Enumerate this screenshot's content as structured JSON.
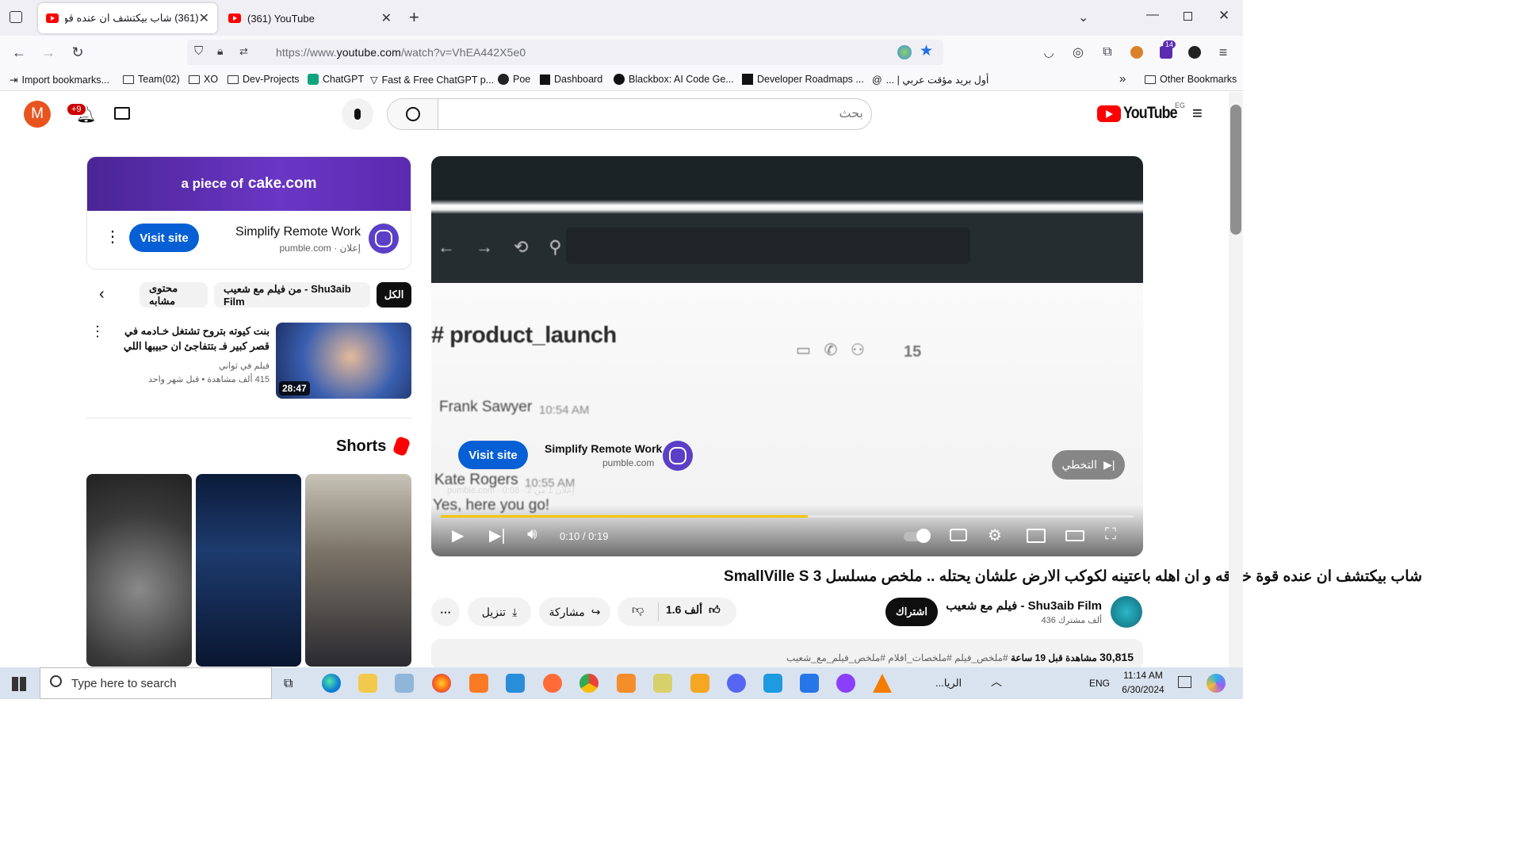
{
  "browser": {
    "tabs": [
      {
        "title": "(361) شاب بيكتشف ان عنده قو",
        "active": true
      },
      {
        "title": "(361) YouTube",
        "active": false
      }
    ],
    "new_tab": "+",
    "url": {
      "prefix": "https://www.",
      "domain": "youtube.com",
      "path": "/watch?v=VhEA442X5e0"
    },
    "extension_badge": "14",
    "bookmarks": [
      "Import bookmarks...",
      "Team(02)",
      "XO",
      "Dev-Projects",
      "ChatGPT",
      "Fast & Free ChatGPT p...",
      "Poe",
      "Dashboard",
      "Blackbox: AI Code Ge...",
      "Developer Roadmaps ...",
      "أول بريد مؤقت عربي | ...",
      "Other Bookmarks"
    ]
  },
  "youtube": {
    "avatar_letter": "M",
    "notifications": "+9",
    "search_placeholder": "بحث",
    "logo": "YouTube",
    "country": "EG",
    "ad": {
      "banner_text": "a piece of",
      "banner_brand": "cake.com",
      "title": "Simplify Remote Work",
      "sub": "pumble.com · إعلان",
      "cta": "Visit site"
    },
    "chips": [
      "الكل",
      "من فيلم مع شعيب - Shu3aib Film",
      "محتوى مشابه"
    ],
    "related": {
      "title": "بنت كيوته بتروح تشتغل خـادمه في قصر كبير فـ بتتفاجئ ان حبيبها اللي اتخلت عنه يبقى غـ...",
      "channel": "فيلم في ثواني",
      "views": "415 ألف مشاهدة",
      "age": "قبل شهر واحد",
      "duration": "28:47"
    },
    "shorts_label": "Shorts",
    "player": {
      "channel_text": "# product_launch",
      "member_count": "15",
      "msg_user": "Frank Sawyer",
      "msg_time": "10:54 AM",
      "msg2_user": "Kate Rogers",
      "msg2_time": "10:55 AM",
      "msg2_text": "Yes, here you go!",
      "overlay_title": "Simplify Remote Work",
      "overlay_domain": "pumble.com",
      "overlay_cta": "Visit site",
      "ad_info": "pumble.com · 0:08 · إعلان 1 من 2",
      "skip": "التخطي",
      "time": "0:10 / 0:19",
      "progress": 0.53
    },
    "video": {
      "title": "شاب بيكتشف ان عنده قوة خارقه و ان اهله باعتينه لكوكب الارض علشان يحتله .. ملخص مسلسل SmallVille S 3",
      "channel": "فيلم مع شعيب - Shu3aib Film",
      "subscribers": "436 ألف مشترك",
      "subscribe": "اشتراك",
      "likes": "1.6 ألف",
      "share": "مشاركة",
      "download": "تنزيل",
      "views_count": "30,815",
      "views_label": "مشاهدة",
      "age": "قبل 19 ساعة",
      "hashtags": "#ملخص_فيلم #ملخصات_افلام #ملخص_فيلم_مع_شعيب"
    }
  },
  "taskbar": {
    "search_placeholder": "Type here to search",
    "weather": "الريا...",
    "lang": "ENG",
    "time": "11:14 AM",
    "date": "6/30/2024"
  }
}
